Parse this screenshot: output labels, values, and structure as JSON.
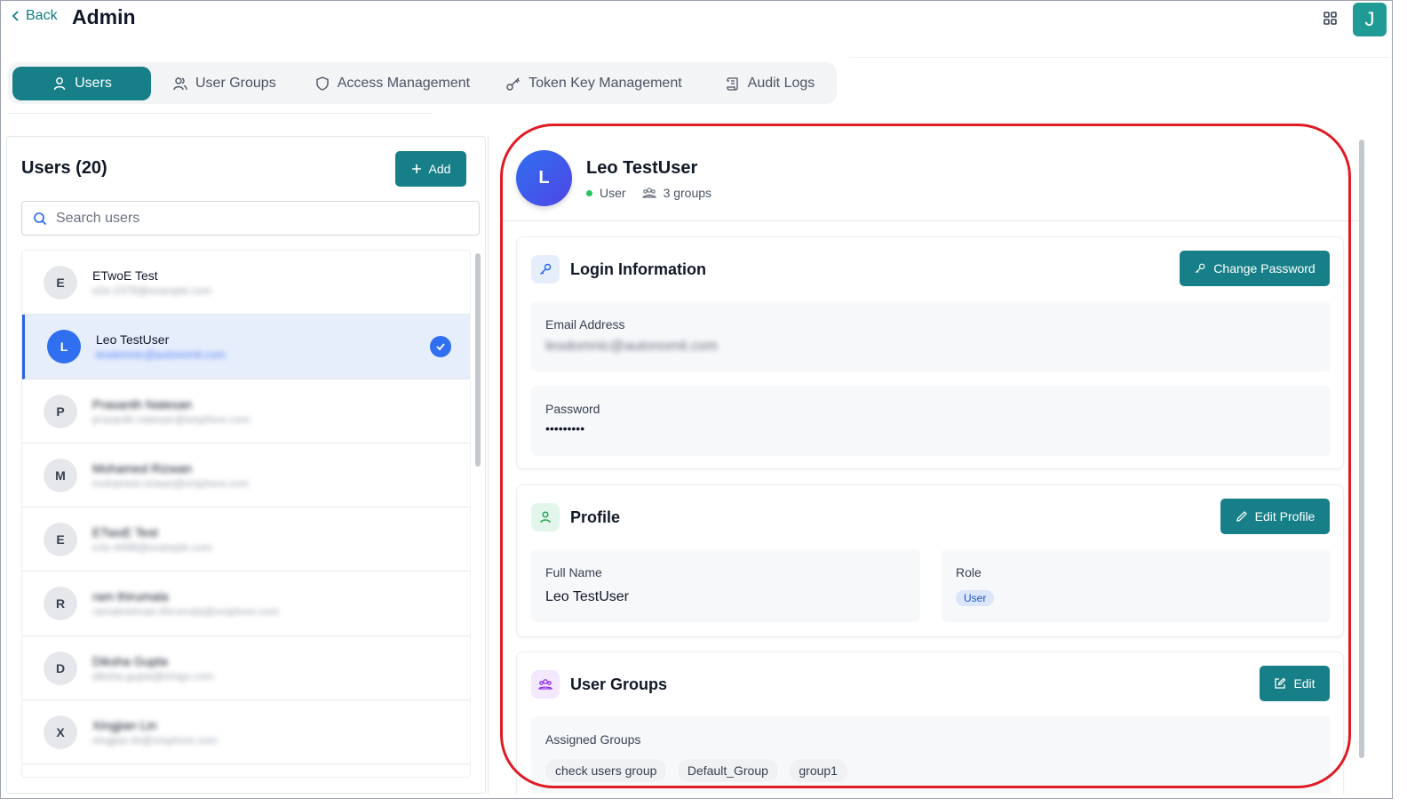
{
  "header": {
    "back_label": "Back",
    "title": "Admin",
    "user_initial": "J"
  },
  "tabs": [
    {
      "label": "Users",
      "icon": "user-icon",
      "active": true
    },
    {
      "label": "User Groups",
      "icon": "users-icon",
      "active": false
    },
    {
      "label": "Access Management",
      "icon": "shield-icon",
      "active": false
    },
    {
      "label": "Token Key Management",
      "icon": "key-icon",
      "active": false
    },
    {
      "label": "Audit Logs",
      "icon": "scroll-icon",
      "active": false
    }
  ],
  "users_panel": {
    "title": "Users (20)",
    "add_label": "Add",
    "search_placeholder": "Search users",
    "users": [
      {
        "initial": "E",
        "name": "ETwoE Test",
        "email": "e2e-2378@example.com",
        "selected": false
      },
      {
        "initial": "L",
        "name": "Leo TestUser",
        "email": "leodomnic@autonomit.com",
        "selected": true
      },
      {
        "initial": "P",
        "name": "Prasanth Natesan",
        "email": "prasanth.natesan@smphore.com",
        "selected": false
      },
      {
        "initial": "M",
        "name": "Mohamed Rizwan",
        "email": "mohamed.rizwan@smphore.com",
        "selected": false
      },
      {
        "initial": "E",
        "name": "ETwoE Test",
        "email": "e2e-4498@example.com",
        "selected": false
      },
      {
        "initial": "R",
        "name": "ram thirumala",
        "email": "ramakrishnan.thirumala@smphore.com",
        "selected": false
      },
      {
        "initial": "D",
        "name": "Diksha Gupta",
        "email": "diksha.gupta@tringo.com",
        "selected": false
      },
      {
        "initial": "X",
        "name": "Xingjian Lin",
        "email": "xingjian.lin@smphore.com",
        "selected": false
      }
    ]
  },
  "detail": {
    "initial": "L",
    "name": "Leo TestUser",
    "role_status": "User",
    "groups_count": "3 groups",
    "login": {
      "title": "Login Information",
      "change_password_label": "Change Password",
      "email_label": "Email Address",
      "email_value": "leodomnic@autonomit.com",
      "password_label": "Password",
      "password_value": "•••••••••"
    },
    "profile": {
      "title": "Profile",
      "edit_label": "Edit Profile",
      "full_name_label": "Full Name",
      "full_name_value": "Leo TestUser",
      "role_label": "Role",
      "role_value": "User"
    },
    "groups": {
      "title": "User Groups",
      "edit_label": "Edit",
      "assigned_label": "Assigned Groups",
      "items": [
        "check users group",
        "Default_Group",
        "group1"
      ]
    }
  },
  "colors": {
    "accent": "#177f88",
    "selected_bg": "#e6eefc",
    "highlight": "#e01b24"
  }
}
